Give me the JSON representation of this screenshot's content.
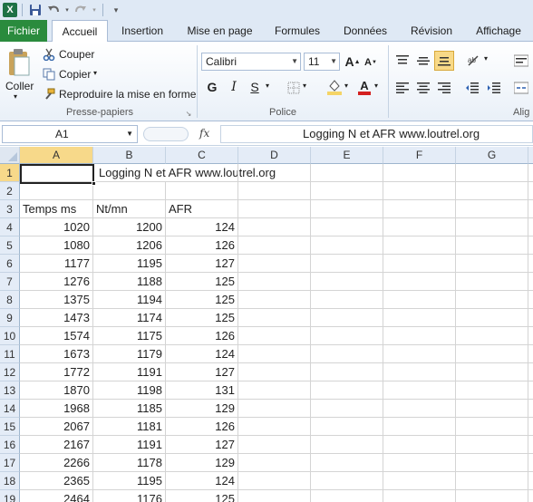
{
  "qat": {
    "app_icon": "excel-icon",
    "save": "save-icon",
    "undo": "undo-icon",
    "redo": "redo-icon",
    "customize": "customize-icon"
  },
  "tabs": {
    "file": "Fichier",
    "home": "Accueil",
    "insert": "Insertion",
    "layout": "Mise en page",
    "formulas": "Formules",
    "data": "Données",
    "review": "Révision",
    "view": "Affichage"
  },
  "clipboard": {
    "paste": "Coller",
    "cut": "Couper",
    "copy": "Copier",
    "format_painter": "Reproduire la mise en forme",
    "label": "Presse-papiers"
  },
  "font": {
    "name": "Calibri",
    "size": "11",
    "bold": "G",
    "italic": "I",
    "underline": "S",
    "label": "Police"
  },
  "alignment": {
    "label": "Alig"
  },
  "formula_bar": {
    "name_box": "A1",
    "fx": "fx",
    "content": "Logging  N  et AFR  www.loutrel.org"
  },
  "columns": [
    "A",
    "B",
    "C",
    "D",
    "E",
    "F",
    "G"
  ],
  "rows": [
    "1",
    "2",
    "3",
    "4",
    "5",
    "6",
    "7",
    "8",
    "9",
    "10",
    "11",
    "12",
    "13",
    "14",
    "15",
    "16",
    "17",
    "18",
    "19"
  ],
  "sheet": {
    "b1": "Logging  N  et AFR  www.loutrel.org",
    "headers": [
      "Temps ms",
      "Nt/mn",
      "AFR"
    ],
    "data": [
      [
        "1020",
        "1200",
        "124"
      ],
      [
        "1080",
        "1206",
        "126"
      ],
      [
        "1177",
        "1195",
        "127"
      ],
      [
        "1276",
        "1188",
        "125"
      ],
      [
        "1375",
        "1194",
        "125"
      ],
      [
        "1473",
        "1174",
        "125"
      ],
      [
        "1574",
        "1175",
        "126"
      ],
      [
        "1673",
        "1179",
        "124"
      ],
      [
        "1772",
        "1191",
        "127"
      ],
      [
        "1870",
        "1198",
        "131"
      ],
      [
        "1968",
        "1185",
        "129"
      ],
      [
        "2067",
        "1181",
        "126"
      ],
      [
        "2167",
        "1191",
        "127"
      ],
      [
        "2266",
        "1178",
        "129"
      ],
      [
        "2365",
        "1195",
        "124"
      ],
      [
        "2464",
        "1176",
        "125"
      ]
    ]
  },
  "colors": {
    "file_tab": "#2a8b3d",
    "ribbon_bg": "#dfe9f5",
    "header_bg": "#e4ecf7",
    "highlight": "#f5d466",
    "font_color": "#d42020"
  }
}
